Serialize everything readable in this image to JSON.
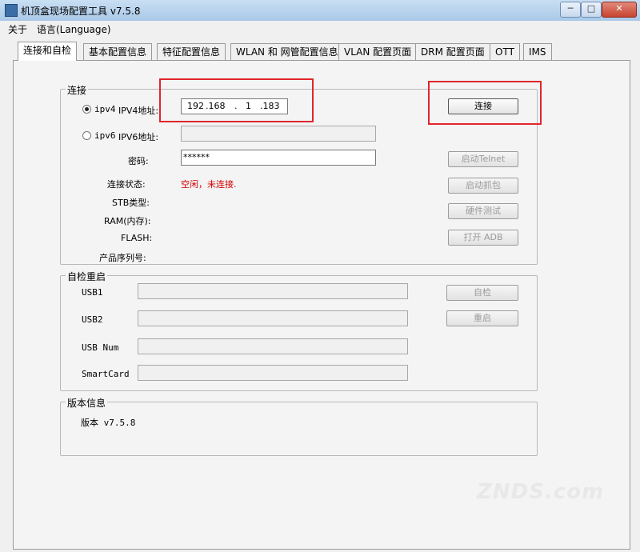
{
  "window": {
    "title": "机顶盒现场配置工具 v7.5.8",
    "min": "─",
    "max": "□",
    "close": "✕"
  },
  "menu": [
    "关于",
    "语言(Language)"
  ],
  "tabs": [
    "连接和自检",
    "基本配置信息",
    "特征配置信息",
    "WLAN 和 网管配置信息",
    "VLAN 配置页面",
    "DRM 配置页面",
    "OTT",
    "IMS"
  ],
  "connect": {
    "group_label": "连接",
    "ipv4_label": "ipv4",
    "ipv4_field_label": "IPV4地址:",
    "ip": [
      "192",
      ".168",
      ".",
      "1",
      ".183"
    ],
    "ipv6_label": "ipv6",
    "ipv6_field_label": "IPV6地址:",
    "password_label": "密码:",
    "password_value": "******",
    "status_label": "连接状态:",
    "status_value": "空闲，未连接.",
    "stb_type_label": "STB类型:",
    "ram_label": "RAM(内存):",
    "flash_label": "FLASH:",
    "serial_label": "产品序列号:",
    "connect_button": "连接",
    "telnet_button": "启动Telnet",
    "capture_button": "启动抓包",
    "hwtest_button": "硬件测试",
    "adb_button": "打开 ADB"
  },
  "selftest": {
    "group_label": "自检重启",
    "usb1_label": "USB1",
    "usb2_label": "USB2",
    "usbnum_label": "USB Num",
    "smartcard_label": "SmartCard",
    "check_button": "自检",
    "reboot_button": "重启"
  },
  "version": {
    "group_label": "版本信息",
    "text": "版本 v7.5.8"
  },
  "watermark": "ZNDS.com"
}
